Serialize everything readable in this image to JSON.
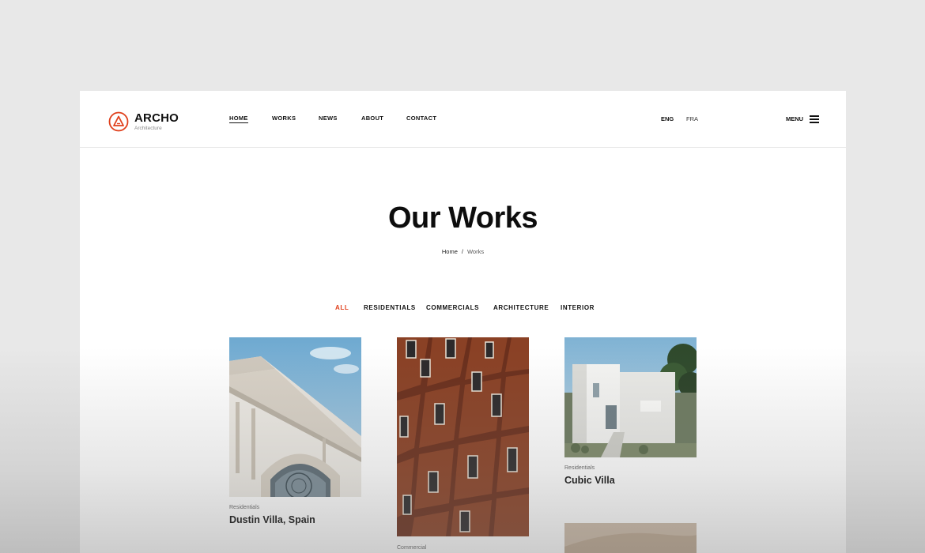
{
  "brand": {
    "name": "ARCHO",
    "tagline": "Architecture",
    "accent_color": "#e0401c",
    "logo_icon": "archo-logo-icon"
  },
  "nav": {
    "items": [
      {
        "label": "HOME",
        "active": true
      },
      {
        "label": "WORKS",
        "active": false
      },
      {
        "label": "NEWS",
        "active": false
      },
      {
        "label": "ABOUT",
        "active": false
      },
      {
        "label": "CONTACT",
        "active": false
      }
    ]
  },
  "languages": [
    {
      "label": "ENG",
      "active": true
    },
    {
      "label": "FRA",
      "active": false
    }
  ],
  "menu": {
    "label": "MENU",
    "icon": "hamburger-icon"
  },
  "hero": {
    "title": "Our Works",
    "breadcrumb": {
      "home": "Home",
      "separator": "/",
      "current": "Works"
    }
  },
  "filters": [
    {
      "label": "ALL",
      "active": true
    },
    {
      "label": "RESIDENTIALS",
      "active": false
    },
    {
      "label": "COMMERCIALS",
      "active": false
    },
    {
      "label": "ARCHITECTURE",
      "active": false
    },
    {
      "label": "INTERIOR",
      "active": false
    }
  ],
  "works": [
    {
      "category": "Residentials",
      "title": "Dustin Villa, Spain",
      "image": "classical-building-photo"
    },
    {
      "category": "Commercial",
      "title": "",
      "image": "wooden-facade-building-photo"
    },
    {
      "category": "Residentials",
      "title": "Cubic Villa",
      "image": "white-cubic-villa-photo"
    },
    {
      "category": "",
      "title": "",
      "image": "beige-interior-photo"
    }
  ]
}
